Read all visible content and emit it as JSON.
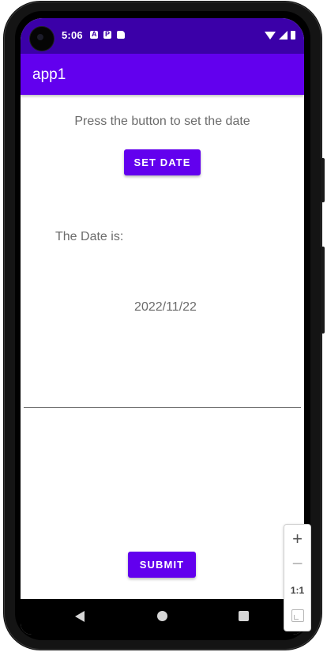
{
  "status_bar": {
    "time": "5:06",
    "notification_icons": [
      "a-notification-icon",
      "p-notification-icon",
      "sd-card-icon"
    ],
    "system_icons": [
      "wifi-icon",
      "signal-icon",
      "battery-icon"
    ]
  },
  "app_bar": {
    "title": "app1",
    "color": "#6200ee"
  },
  "main": {
    "prompt": "Press the button to set the date",
    "set_date_label": "SET DATE",
    "date_label": "The Date is:",
    "date_value": "2022/11/22",
    "submit_label": "SUBMIT"
  },
  "nav_bar": {
    "items": [
      "back-icon",
      "home-icon",
      "recents-icon"
    ]
  },
  "zoom_controls": {
    "zoom_in_label": "+",
    "zoom_out_label": "−",
    "reset_label": "1:1"
  },
  "colors": {
    "accent": "#6200ee",
    "status_bar": "#3b00a8",
    "text_secondary": "#6b6b6b"
  }
}
